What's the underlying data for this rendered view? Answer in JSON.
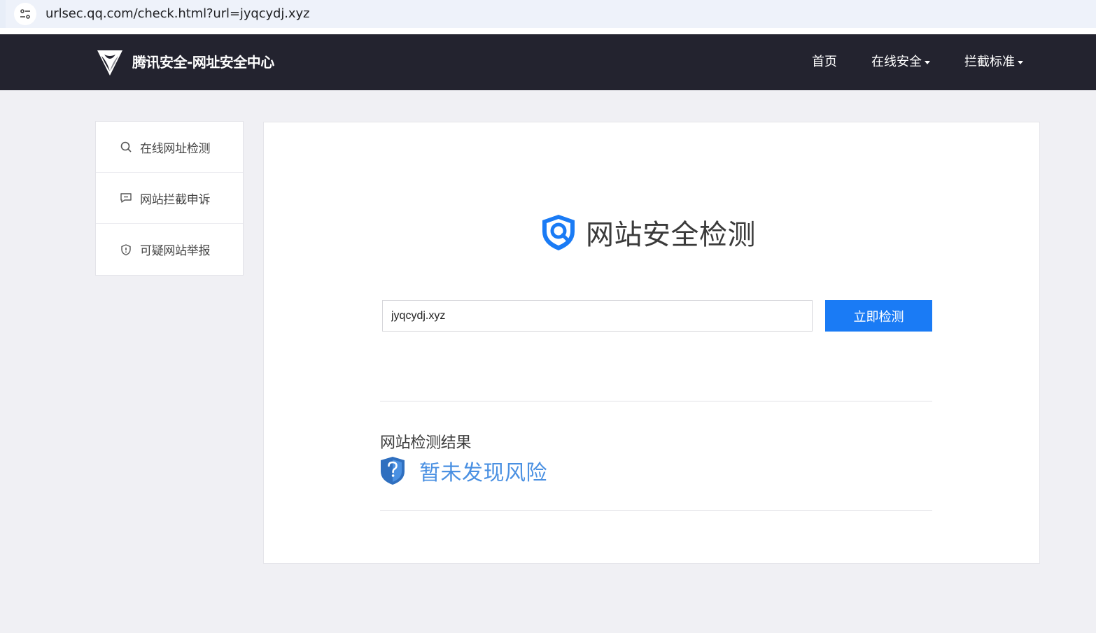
{
  "browser": {
    "url": "urlsec.qq.com/check.html?url=jyqcydj.xyz"
  },
  "header": {
    "logo_text": "腾讯安全-网址安全中心",
    "nav": [
      {
        "label": "首页"
      },
      {
        "label": "在线安全"
      },
      {
        "label": "拦截标准"
      }
    ]
  },
  "sidebar": {
    "items": [
      {
        "label": "在线网址检测",
        "icon": "search-icon"
      },
      {
        "label": "网站拦截申诉",
        "icon": "message-icon"
      },
      {
        "label": "可疑网站举报",
        "icon": "shield-alert-icon"
      }
    ]
  },
  "main": {
    "title": "网站安全检测",
    "input_value": "jyqcydj.xyz",
    "button_label": "立即检测",
    "result_label": "网站检测结果",
    "result_text": "暂未发现风险"
  },
  "colors": {
    "navbar": "#23232f",
    "accent": "#1a7bf5",
    "result": "#4a90e2",
    "background": "#f0f0f4"
  }
}
